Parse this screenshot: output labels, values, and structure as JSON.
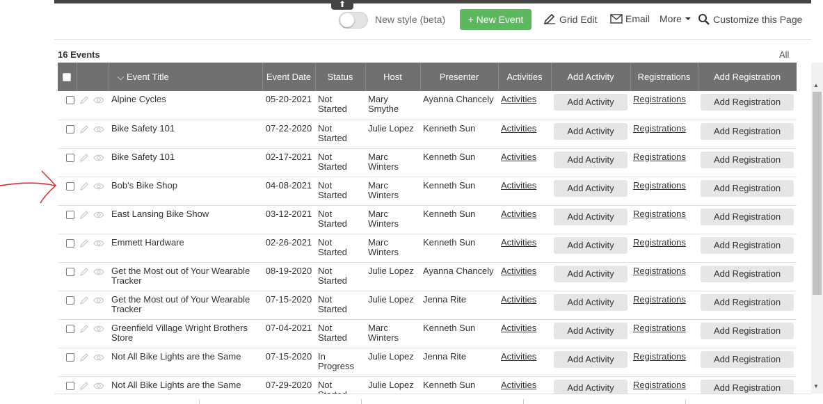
{
  "toolbar": {
    "toggle_label": "New style (beta)",
    "new_event": "+ New Event",
    "grid_edit": "Grid Edit",
    "email": "Email",
    "more": "More",
    "customize": "Customize this Page"
  },
  "summary": {
    "count": "16 Events",
    "all": "All"
  },
  "columns": {
    "title": "Event Title",
    "date": "Event Date",
    "status": "Status",
    "host": "Host",
    "presenter": "Presenter",
    "activities": "Activities",
    "add_activity": "Add Activity",
    "registrations": "Registrations",
    "add_registration": "Add Registration"
  },
  "rows": [
    {
      "title": "Alpine Cycles",
      "date": "05-20-2021",
      "status": "Not Started",
      "host": "Mary Smythe",
      "presenter": "Ayanna Chancely",
      "activities": "Activities",
      "add_activity": "Add Activity",
      "registrations": "Registrations",
      "add_registration": "Add Registration"
    },
    {
      "title": "Bike Safety 101",
      "date": "07-22-2020",
      "status": "Not Started",
      "host": "Julie Lopez",
      "presenter": "Kenneth Sun",
      "activities": "Activities",
      "add_activity": "Add Activity",
      "registrations": "Registrations",
      "add_registration": "Add Registration"
    },
    {
      "title": "Bike Safety 101",
      "date": "02-17-2021",
      "status": "Not Started",
      "host": "Marc Winters",
      "presenter": "Kenneth Sun",
      "activities": "Activities",
      "add_activity": "Add Activity",
      "registrations": "Registrations",
      "add_registration": "Add Registration"
    },
    {
      "title": "Bob's Bike Shop",
      "date": "04-08-2021",
      "status": "Not Started",
      "host": "Marc Winters",
      "presenter": "Kenneth Sun",
      "activities": "Activities",
      "add_activity": "Add Activity",
      "registrations": "Registrations",
      "add_registration": "Add Registration"
    },
    {
      "title": "East Lansing Bike Show",
      "date": "03-12-2021",
      "status": "Not Started",
      "host": "Marc Winters",
      "presenter": "Kenneth Sun",
      "activities": "Activities",
      "add_activity": "Add Activity",
      "registrations": "Registrations",
      "add_registration": "Add Registration"
    },
    {
      "title": "Emmett Hardware",
      "date": "02-26-2021",
      "status": "Not Started",
      "host": "Marc Winters",
      "presenter": "Kenneth Sun",
      "activities": "Activities",
      "add_activity": "Add Activity",
      "registrations": "Registrations",
      "add_registration": "Add Registration"
    },
    {
      "title": "Get the Most out of Your Wearable Tracker",
      "date": "08-19-2020",
      "status": "Not Started",
      "host": "Julie Lopez",
      "presenter": "Ayanna Chancely",
      "activities": "Activities",
      "add_activity": "Add Activity",
      "registrations": "Registrations",
      "add_registration": "Add Registration"
    },
    {
      "title": "Get the Most out of Your Wearable Tracker",
      "date": "07-15-2020",
      "status": "Not Started",
      "host": "Julie Lopez",
      "presenter": "Jenna Rite",
      "activities": "Activities",
      "add_activity": "Add Activity",
      "registrations": "Registrations",
      "add_registration": "Add Registration"
    },
    {
      "title": "Greenfield Village Wright Brothers Store",
      "date": "07-04-2021",
      "status": "Not Started",
      "host": "Marc Winters",
      "presenter": "Kenneth Sun",
      "activities": "Activities",
      "add_activity": "Add Activity",
      "registrations": "Registrations",
      "add_registration": "Add Registration"
    },
    {
      "title": "Not All Bike Lights are the Same",
      "date": "07-15-2020",
      "status": "In Progress",
      "host": "Julie Lopez",
      "presenter": "Jenna Rite",
      "activities": "Activities",
      "add_activity": "Add Activity",
      "registrations": "Registrations",
      "add_registration": "Add Registration"
    },
    {
      "title": "Not All Bike Lights are the Same",
      "date": "07-29-2020",
      "status": "Not Started",
      "host": "Julie Lopez",
      "presenter": "Kenneth Sun",
      "activities": "Activities",
      "add_activity": "Add Activity",
      "registrations": "Registrations",
      "add_registration": "Add Registration"
    }
  ],
  "colors": {
    "header_bg": "#707070",
    "new_event_bg": "#5cb85c",
    "annotation": "#e0201b"
  },
  "icons": [
    "upload-icon",
    "pencil-icon",
    "envelope-icon",
    "caret-down-icon",
    "magnifier-icon",
    "edit-icon",
    "eye-icon",
    "sort-caret-icon"
  ]
}
